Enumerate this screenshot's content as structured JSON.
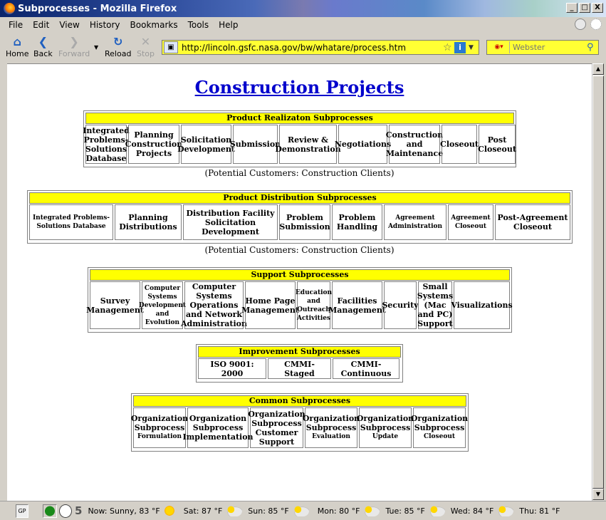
{
  "window": {
    "title": "Subprocesses - Mozilla Firefox",
    "buttons": [
      "_",
      "□",
      "X"
    ]
  },
  "menu": [
    "File",
    "Edit",
    "View",
    "History",
    "Bookmarks",
    "Tools",
    "Help"
  ],
  "nav": {
    "home": "Home",
    "back": "Back",
    "forward": "Forward",
    "reload": "Reload",
    "stop": "Stop",
    "url": "http://lincoln.gsfc.nasa.gov/bw/whatare/process.htm",
    "search_placeholder": "Webster"
  },
  "page": {
    "title": "Construction Projects",
    "potential_customers": "(Potential Customers: Construction Clients)",
    "tables": [
      {
        "header": "Product Realizaton Subprocesses",
        "cells": [
          "Integrated Problems-Solutions Database",
          "Planning Construction Projects",
          "Solicitation Development",
          "Submission",
          "Review & Demonstration",
          "Negotiations",
          "Construction and Maintenance",
          "Closeout",
          "Post Closeout"
        ]
      },
      {
        "header": "Product Distribution Subprocesses",
        "cells": [
          "Integrated Problems-Solutions Database",
          "Planning Distributions",
          "Distribution Facility Solicitation Development",
          "Problem Submission",
          "Problem Handling",
          "Agreement Administration",
          "Agreement Closeout",
          "Post-Agreement Closeout"
        ]
      },
      {
        "header": "Support Subprocesses",
        "cells": [
          "Survey Management",
          "Computer Systems Development and Evolution",
          "Computer Systems Operations and Network Administration",
          "Home Page Management",
          "Education and Outreach Activities",
          "Facilities Management",
          "Security",
          "Small Systems (Mac and PC) Support",
          "Visualizations"
        ]
      },
      {
        "header": "Improvement Subprocesses",
        "cells": [
          "ISO 9001: 2000",
          "CMMI- Staged",
          "CMMI- Continuous"
        ]
      },
      {
        "header": "Common Subprocesses",
        "cells": [
          {
            "main": "Organization Subprocess",
            "sub": "Formulation"
          },
          {
            "main": "Organization Subprocess",
            "sub": "Implementation"
          },
          {
            "main": "Organization Subprocess",
            "sub": "Customer Support"
          },
          {
            "main": "Organization Subprocess",
            "sub": "Evaluation"
          },
          {
            "main": "Organization Subprocess",
            "sub": "Update"
          },
          {
            "main": "Organization Subprocess",
            "sub": "Closeout"
          }
        ]
      }
    ]
  },
  "status": {
    "gp": "GP",
    "num": "5",
    "weather": [
      {
        "label": "Now: Sunny, 83 °F",
        "icon": "sun-icon"
      },
      {
        "label": "Sat: 87 °F",
        "icon": "partly-cloudy-icon"
      },
      {
        "label": "Sun: 85 °F",
        "icon": "partly-cloudy-icon"
      },
      {
        "label": "Mon: 80 °F",
        "icon": "partly-cloudy-icon"
      },
      {
        "label": "Tue: 85 °F",
        "icon": "partly-cloudy-icon"
      },
      {
        "label": "Wed: 84 °F",
        "icon": "partly-cloudy-icon"
      },
      {
        "label": "Thu: 81 °F",
        "icon": "partly-cloudy-icon"
      }
    ]
  }
}
